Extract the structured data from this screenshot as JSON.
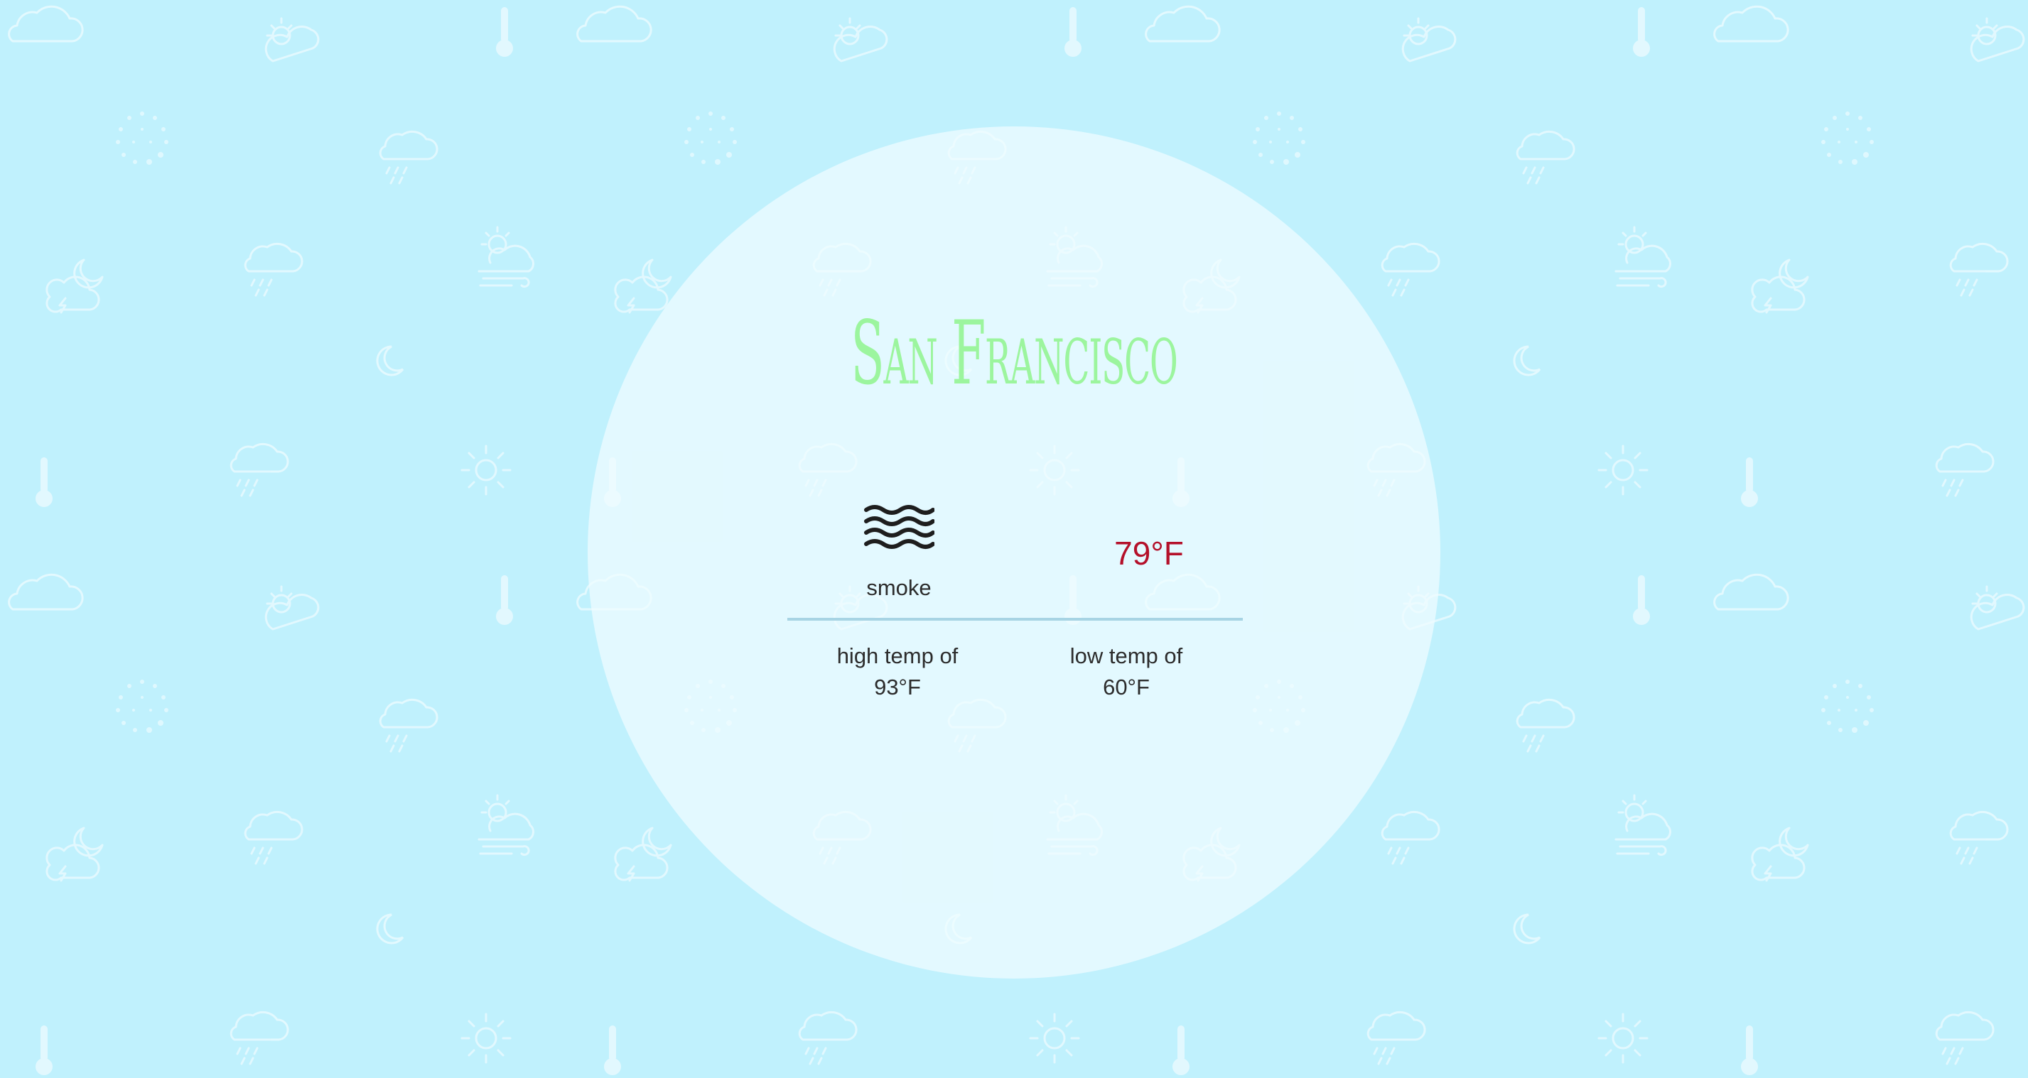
{
  "city": "San Francisco",
  "current": {
    "condition": "smoke",
    "condition_icon": "smoke-waves-icon",
    "temperature": "79°F"
  },
  "high": {
    "label": "high temp of",
    "value": "93°F"
  },
  "low": {
    "label": "low temp of",
    "value": "60°F"
  },
  "colors": {
    "background": "#c0f1fd",
    "city_text": "#9cf59e",
    "current_temp": "#b4102a",
    "divider": "#a7d4e4"
  }
}
